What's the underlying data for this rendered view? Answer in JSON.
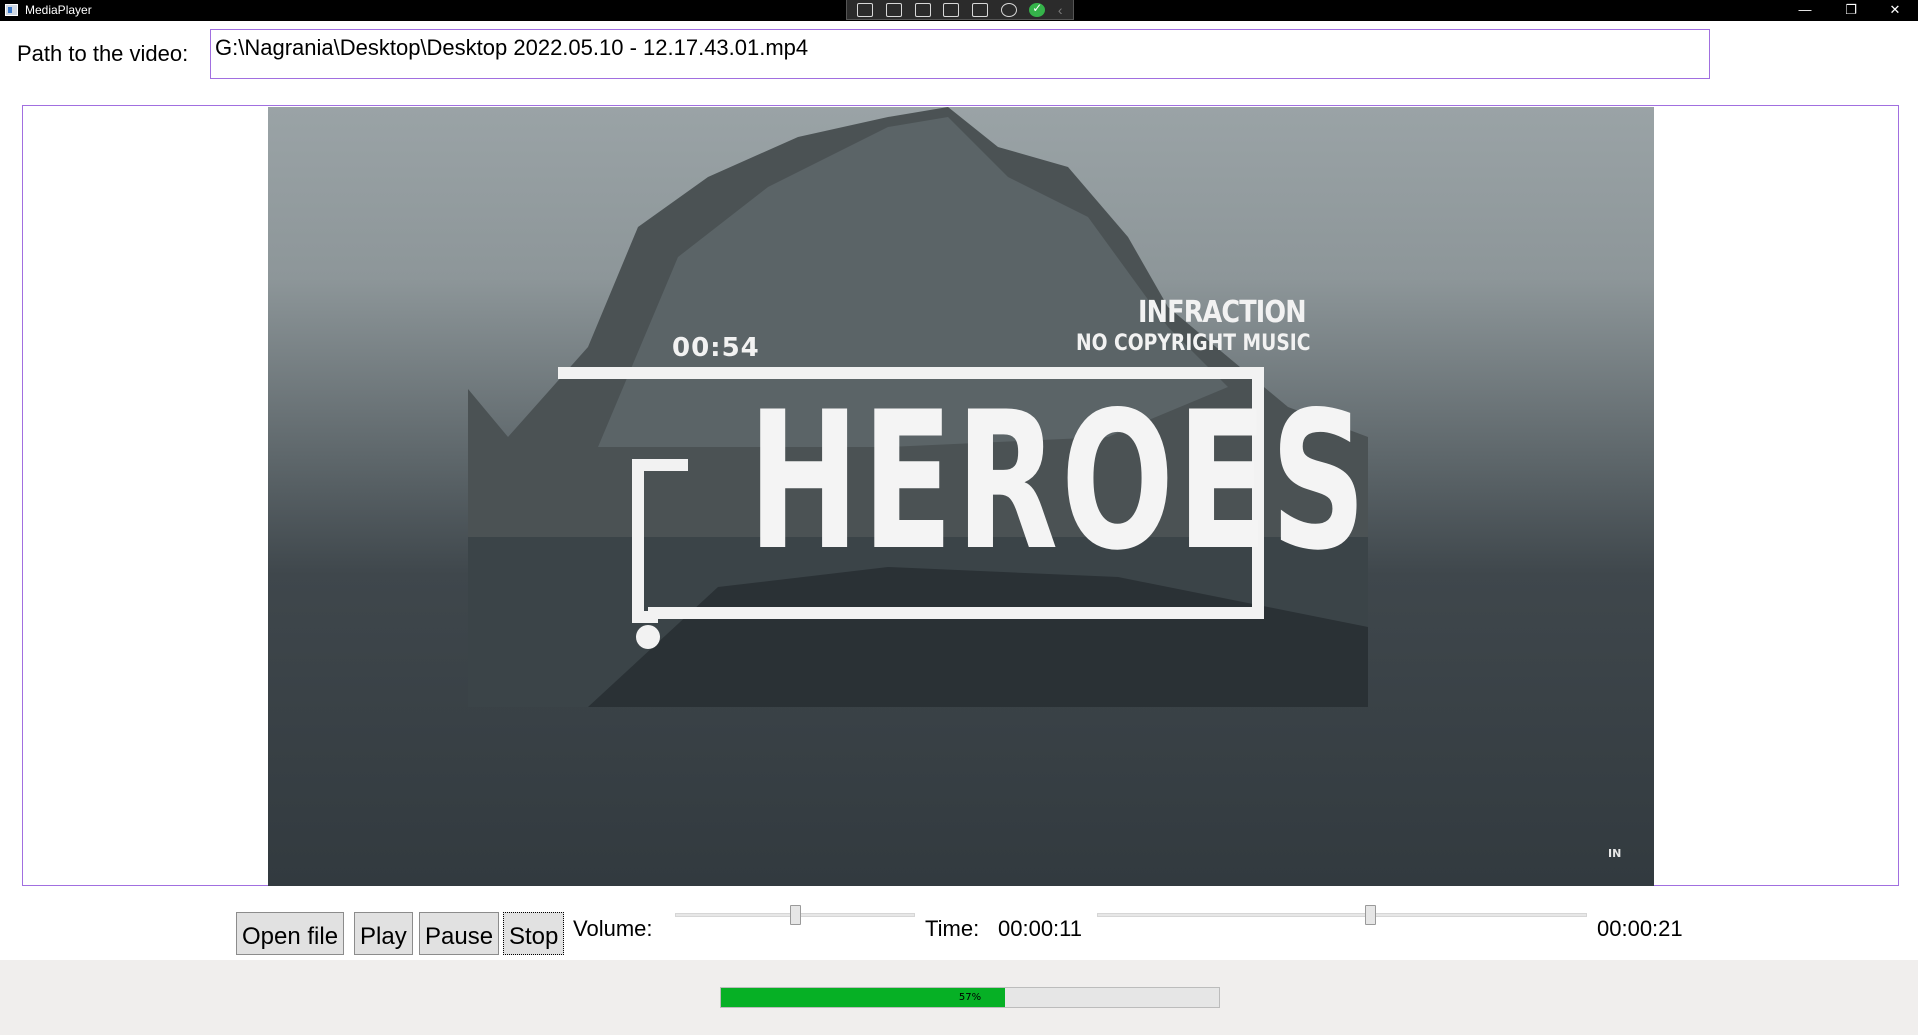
{
  "window": {
    "title": "MediaPlayer",
    "minimize_glyph": "—",
    "restore_glyph": "❐",
    "close_glyph": "✕"
  },
  "devtools": {
    "icons": [
      "live-visual-tree-icon",
      "camera-icon",
      "select-element-icon",
      "display-layout-adorners-icon",
      "track-focused-element-icon",
      "binding-failures-icon",
      "hot-reload-ok-icon"
    ],
    "collapse_glyph": "‹"
  },
  "path": {
    "label": "Path to the video:",
    "value": "G:\\Nagrania\\Desktop\\Desktop 2022.05.10 - 12.17.43.01.mp4"
  },
  "video": {
    "overlay_time": "00:54",
    "brand_line1": "INFRACTION",
    "brand_line2": "NO COPYRIGHT MUSIC",
    "title": "HEROES",
    "watermark": "IN"
  },
  "controls": {
    "open_label": "Open file",
    "play_label": "Play",
    "pause_label": "Pause",
    "stop_label": "Stop",
    "volume_label": "Volume:",
    "volume_level": 0.5,
    "time_label": "Time:",
    "current_time": "00:00:11",
    "total_time": "00:00:21",
    "time_level": 0.56
  },
  "progress": {
    "percent": 57,
    "text": "57%",
    "color": "#06b025"
  },
  "colors": {
    "accent_border": "#a16fe0",
    "button_bg": "#e1e1e1"
  }
}
